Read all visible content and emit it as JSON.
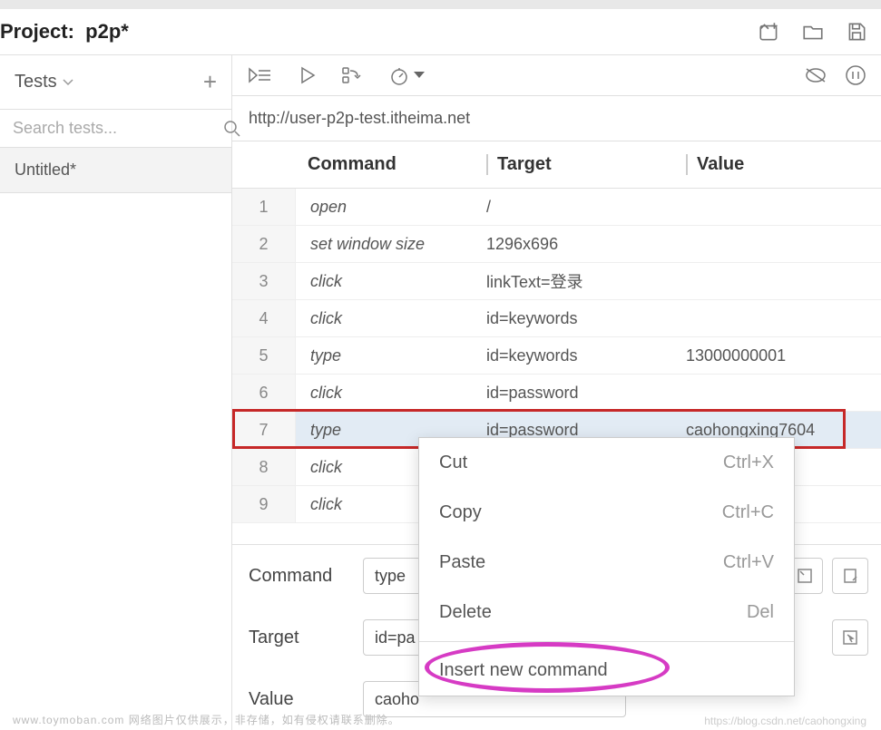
{
  "project": {
    "label": "Project:",
    "name": "p2p*"
  },
  "sidebar": {
    "tests_label": "Tests",
    "search_placeholder": "Search tests...",
    "items": [
      {
        "label": "Untitled*"
      }
    ]
  },
  "url": "http://user-p2p-test.itheima.net",
  "columns": {
    "command": "Command",
    "target": "Target",
    "value": "Value"
  },
  "rows": [
    {
      "n": "1",
      "command": "open",
      "target": "/",
      "value": ""
    },
    {
      "n": "2",
      "command": "set window size",
      "target": "1296x696",
      "value": ""
    },
    {
      "n": "3",
      "command": "click",
      "target": "linkText=登录",
      "value": ""
    },
    {
      "n": "4",
      "command": "click",
      "target": "id=keywords",
      "value": ""
    },
    {
      "n": "5",
      "command": "type",
      "target": "id=keywords",
      "value": "13000000001"
    },
    {
      "n": "6",
      "command": "click",
      "target": "id=password",
      "value": ""
    },
    {
      "n": "7",
      "command": "type",
      "target": "id=password",
      "value": "caohongxing7604",
      "selected": true
    },
    {
      "n": "8",
      "command": "click",
      "target": "",
      "value": ""
    },
    {
      "n": "9",
      "command": "click",
      "target": "",
      "value": ""
    }
  ],
  "details": {
    "command_label": "Command",
    "command_value": "type",
    "target_label": "Target",
    "target_value": "id=pa",
    "value_label": "Value",
    "value_value": "caoho"
  },
  "context_menu": [
    {
      "label": "Cut",
      "shortcut": "Ctrl+X"
    },
    {
      "label": "Copy",
      "shortcut": "Ctrl+C"
    },
    {
      "label": "Paste",
      "shortcut": "Ctrl+V"
    },
    {
      "label": "Delete",
      "shortcut": "Del"
    },
    {
      "divider": true
    },
    {
      "label": "Insert new command",
      "shortcut": ""
    }
  ],
  "watermark": "www.toymoban.com 网络图片仅供展示，非存储，如有侵权请联系删除。",
  "watermark2": "https://blog.csdn.net/caohongxing"
}
